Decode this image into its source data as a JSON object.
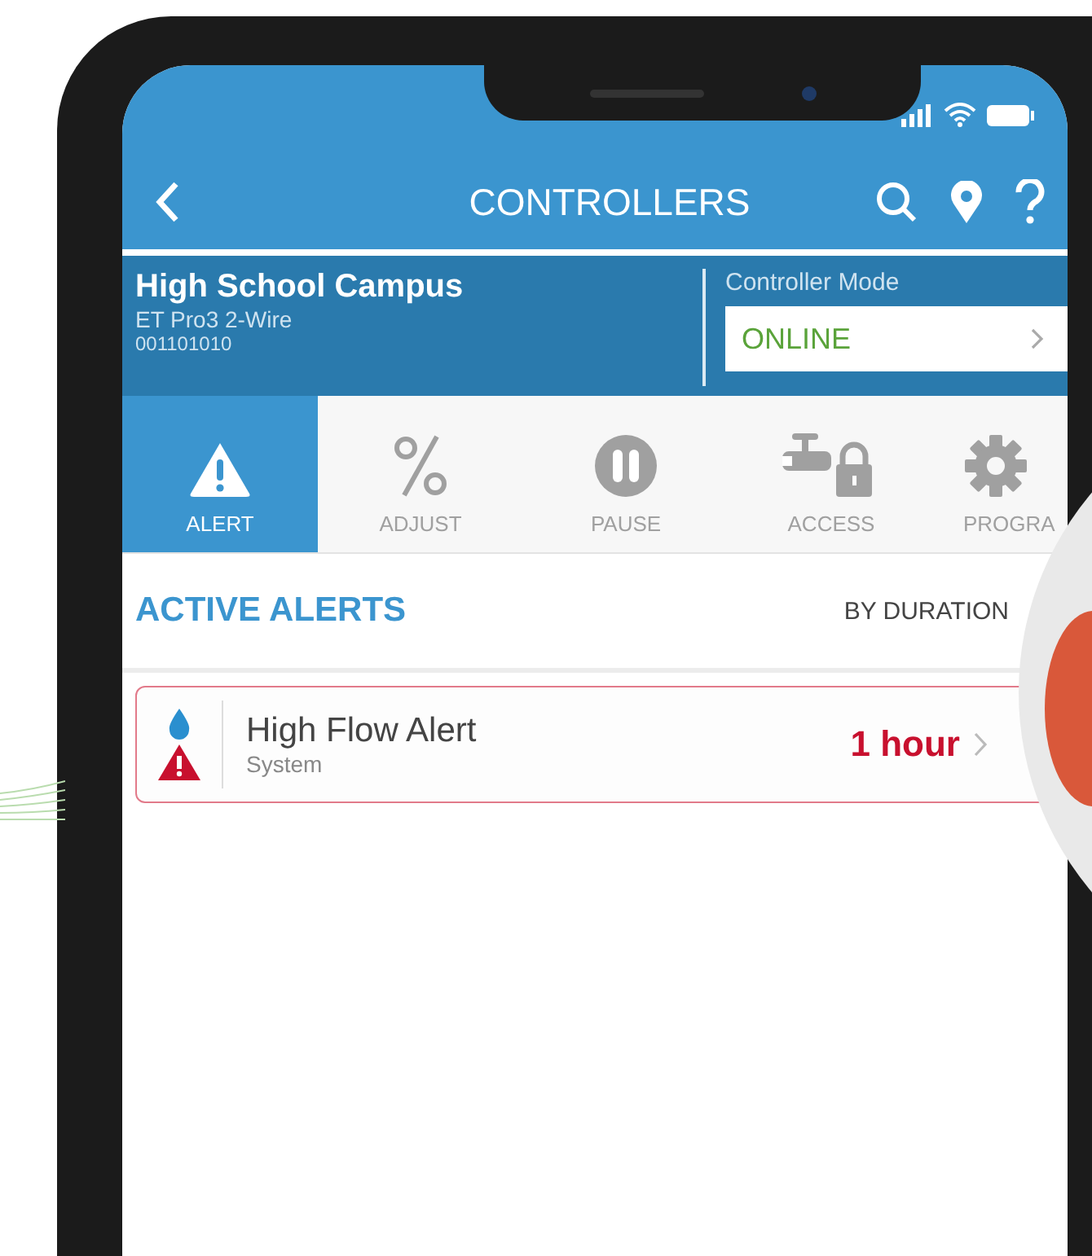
{
  "nav": {
    "title": "CONTROLLERS"
  },
  "controller": {
    "name": "High School Campus",
    "model": "ET Pro3 2-Wire",
    "serial": "001101010",
    "mode_label": "Controller Mode",
    "mode": "ONLINE"
  },
  "tabs": [
    {
      "label": "ALERT",
      "kind": "alert",
      "selected": true
    },
    {
      "label": "ADJUST",
      "kind": "adjust",
      "selected": false
    },
    {
      "label": "PAUSE",
      "kind": "pause",
      "selected": false
    },
    {
      "label": "ACCESS",
      "kind": "access",
      "selected": false
    },
    {
      "label": "PROGRA",
      "kind": "program",
      "selected": false
    }
  ],
  "section": {
    "title": "ACTIVE ALERTS",
    "sort": "BY DURATION"
  },
  "alerts": [
    {
      "title": "High Flow Alert",
      "source": "System",
      "duration": "1 hour"
    }
  ]
}
